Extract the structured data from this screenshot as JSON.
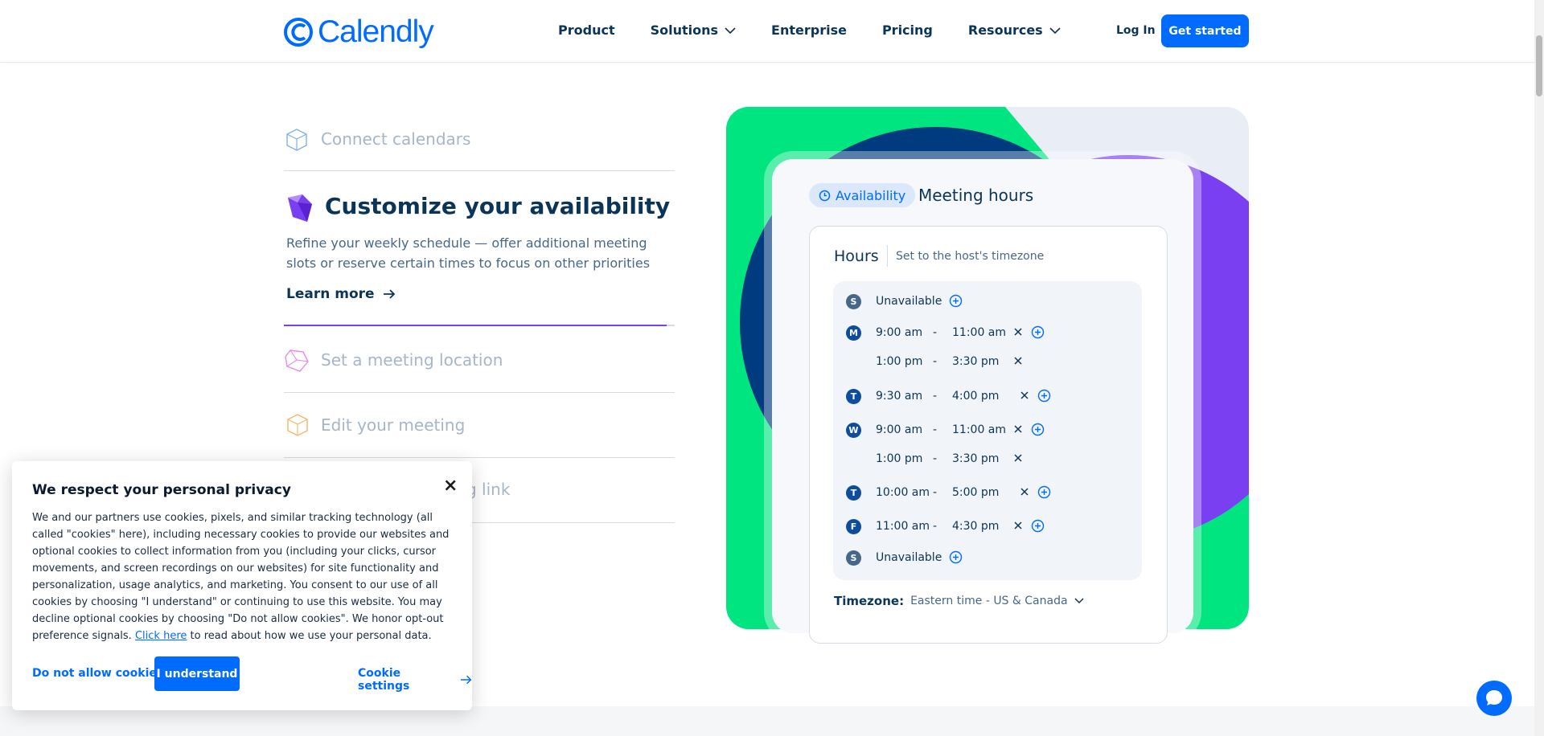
{
  "header": {
    "logo_text": "Calendly",
    "nav": [
      "Product",
      "Solutions",
      "Enterprise",
      "Pricing",
      "Resources"
    ],
    "login": "Log In",
    "cta": "Get started"
  },
  "features": {
    "items": [
      {
        "title": "Connect calendars"
      },
      {
        "title": "Customize your availability"
      },
      {
        "title": "Set a meeting location"
      },
      {
        "title": "Edit your meeting"
      },
      {
        "title": "g link"
      }
    ],
    "active_description": "Refine your weekly schedule — offer additional meeting slots or reserve certain times to focus on other priorities",
    "learn_more": "Learn more",
    "progress_fraction": 0.98
  },
  "illustration": {
    "pill": "Availability",
    "title": "Meeting hours",
    "hours_label": "Hours",
    "hours_sub": "Set to the host's timezone",
    "schedule": [
      {
        "day": "S",
        "unavailable": "Unavailable"
      },
      {
        "day": "M",
        "start": "9:00 am",
        "end": "11:00 am"
      },
      {
        "start": "1:00 pm",
        "end": "3:30 pm"
      },
      {
        "day": "T",
        "start": "9:30 am",
        "end": "4:00 pm"
      },
      {
        "day": "W",
        "start": "9:00 am",
        "end": "11:00 am"
      },
      {
        "start": "1:00 pm",
        "end": "3:30 pm"
      },
      {
        "day": "T",
        "start": "10:00 am",
        "end": "5:00 pm"
      },
      {
        "day": "F",
        "start": "11:00 am",
        "end": "4:30 pm"
      },
      {
        "day": "S",
        "unavailable": "Unavailable"
      }
    ],
    "timezone_label": "Timezone:",
    "timezone_value": "Eastern time - US & Canada"
  },
  "cookie": {
    "title": "We respect your personal privacy",
    "body": "We and our partners use cookies, pixels, and similar tracking technology (all called \"cookies\" here), including necessary cookies to provide our websites and optional cookies to collect information from you (including your clicks, cursor movements, and screen recordings on our websites) for site functionality and personalization, usage analytics, and marketing. You consent to our use of all cookies by choosing \"I understand\" or continuing to use this website. You may decline optional cookies by choosing \"Do not allow cookies\". We honor opt-out preference signals.",
    "link": "Click here",
    "after_link": "to read about how we use your personal data.",
    "decline": "Do not allow cookies",
    "accept": "I understand",
    "settings": "Cookie settings",
    "close": "×"
  },
  "colors": {
    "brand": "#006bff",
    "navy": "#0b3558",
    "green": "#00e57f",
    "purple": "#7a3ff0",
    "dark_blue": "#003a7f"
  }
}
